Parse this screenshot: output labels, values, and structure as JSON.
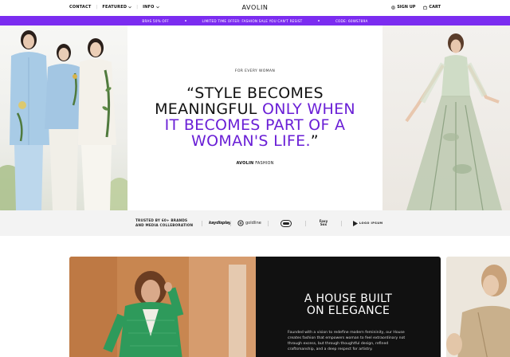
{
  "nav": {
    "contact": "CONTACT",
    "featured": "FEATURED",
    "info": "INFO",
    "logo": "AVOLIN",
    "sign_up": "SIGN UP",
    "cart": "CART"
  },
  "promo": {
    "messages": [
      "BRAS 50% OFF",
      "LIMITED TIME OFFER: FASHION SALE YOU CAN'T RESIST",
      "CODE: 60WS789A"
    ],
    "background": "#7b2cf0"
  },
  "hero": {
    "eyebrow": "FOR EVERY WOMAN",
    "quote_line1": "“STYLE BECOMES",
    "quote_line2_plain": "MEANINGFUL ",
    "quote_line2_accent": "ONLY WHEN",
    "quote_line3_accent": "IT BECOMES PART OF A",
    "quote_line4_accent": "WOMAN'S LIFE.",
    "quote_close": "”",
    "signature_bold": "AVOLIN",
    "signature_rest": " FASHION",
    "accent_color": "#6a1fd6"
  },
  "trust": {
    "label_line1": "TRUSTED BY 60+ BRANDS",
    "label_line2": "AND MEDIA COLLEBORATION",
    "brands": [
      "kaydisplay",
      "goldline",
      "Foxy Sox",
      "LOGO IPSUM"
    ]
  },
  "story": {
    "title_line1": "A HOUSE BUILT",
    "title_line2": "ON ELEGANCE",
    "body": "Founded with a vision to redefine modern femininity, our House creates fashion that empowers woman to feel extraordinary not through excess, but through thoughtful design, refined craftsmanship, and a deep respect for artistry."
  }
}
